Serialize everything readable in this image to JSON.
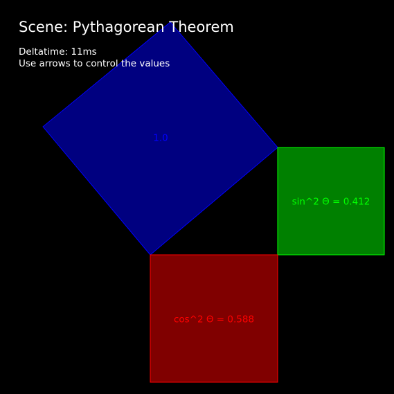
{
  "scene": {
    "title": "Scene: Pythagorean Theorem",
    "deltatime": "Deltatime: 11ms",
    "instructions": "Use arrows to control the values"
  },
  "squares": {
    "hypotenuse": {
      "label": "1.0",
      "fill": "#000080",
      "stroke": "#0000ff",
      "text_color": "#0000ff"
    },
    "sine": {
      "label": "sin^2 Θ = 0.412",
      "value": 0.412,
      "fill": "#008000",
      "stroke": "#00ff00",
      "text_color": "#00ff00"
    },
    "cosine": {
      "label": "cos^2 Θ = 0.588",
      "value": 0.588,
      "fill": "#800000",
      "stroke": "#ff0000",
      "text_color": "#ff0000"
    }
  },
  "colors": {
    "background": "#000000",
    "hud_text": "#ffffff"
  }
}
